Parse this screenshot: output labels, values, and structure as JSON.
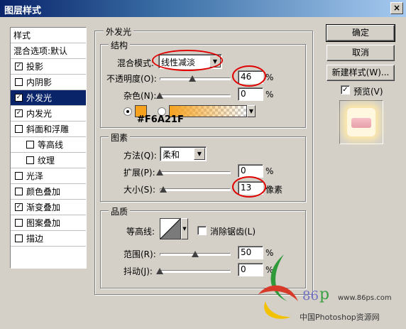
{
  "window": {
    "title": "图层样式",
    "close_symbol": "×"
  },
  "styles_list": {
    "header": "样式",
    "items": [
      {
        "label": "混合选项:默认",
        "checkbox": false,
        "checked": false,
        "indent": false,
        "selected": false
      },
      {
        "label": "投影",
        "checkbox": true,
        "checked": true,
        "indent": false,
        "selected": false
      },
      {
        "label": "内阴影",
        "checkbox": true,
        "checked": false,
        "indent": false,
        "selected": false
      },
      {
        "label": "外发光",
        "checkbox": true,
        "checked": true,
        "indent": false,
        "selected": true
      },
      {
        "label": "内发光",
        "checkbox": true,
        "checked": true,
        "indent": false,
        "selected": false
      },
      {
        "label": "斜面和浮雕",
        "checkbox": true,
        "checked": false,
        "indent": false,
        "selected": false
      },
      {
        "label": "等高线",
        "checkbox": true,
        "checked": false,
        "indent": true,
        "selected": false
      },
      {
        "label": "纹理",
        "checkbox": true,
        "checked": false,
        "indent": true,
        "selected": false
      },
      {
        "label": "光泽",
        "checkbox": true,
        "checked": false,
        "indent": false,
        "selected": false
      },
      {
        "label": "颜色叠加",
        "checkbox": true,
        "checked": false,
        "indent": false,
        "selected": false
      },
      {
        "label": "渐变叠加",
        "checkbox": true,
        "checked": true,
        "indent": false,
        "selected": false
      },
      {
        "label": "图案叠加",
        "checkbox": true,
        "checked": false,
        "indent": false,
        "selected": false
      },
      {
        "label": "描边",
        "checkbox": true,
        "checked": false,
        "indent": false,
        "selected": false
      }
    ]
  },
  "outer_glow": {
    "title": "外发光",
    "structure": {
      "title": "结构",
      "blend_mode_label": "混合模式:",
      "blend_mode_value": "线性减淡",
      "opacity_label": "不透明度(O):",
      "opacity_value": "46",
      "opacity_level": 0.46,
      "noise_label": "杂色(N):",
      "noise_value": "0",
      "noise_level": 0,
      "percent": "%",
      "color_hex_annotation": "#F6A21F",
      "glow_color": "#f6a21f"
    },
    "elements": {
      "title": "图素",
      "method_label": "方法(Q):",
      "method_value": "柔和",
      "spread_label": "扩展(P):",
      "spread_value": "0",
      "spread_level": 0,
      "size_label": "大小(S):",
      "size_value": "13",
      "size_level": 0.05,
      "size_unit": "像素",
      "percent": "%"
    },
    "quality": {
      "title": "品质",
      "contour_label": "等高线:",
      "antialias_label": "消除锯齿(L)",
      "range_label": "范围(R):",
      "range_value": "50",
      "range_level": 0.5,
      "jitter_label": "抖动(J):",
      "jitter_value": "0",
      "jitter_level": 0,
      "percent": "%"
    }
  },
  "buttons": {
    "ok": "确定",
    "cancel": "取消",
    "new_style": "新建样式(W)...",
    "preview_label": "预览(V)"
  },
  "watermark": {
    "brand_digits": "86",
    "brand_letter": "p",
    "url": "www.86ps.com",
    "site_name": "中国Photoshop资源网"
  }
}
